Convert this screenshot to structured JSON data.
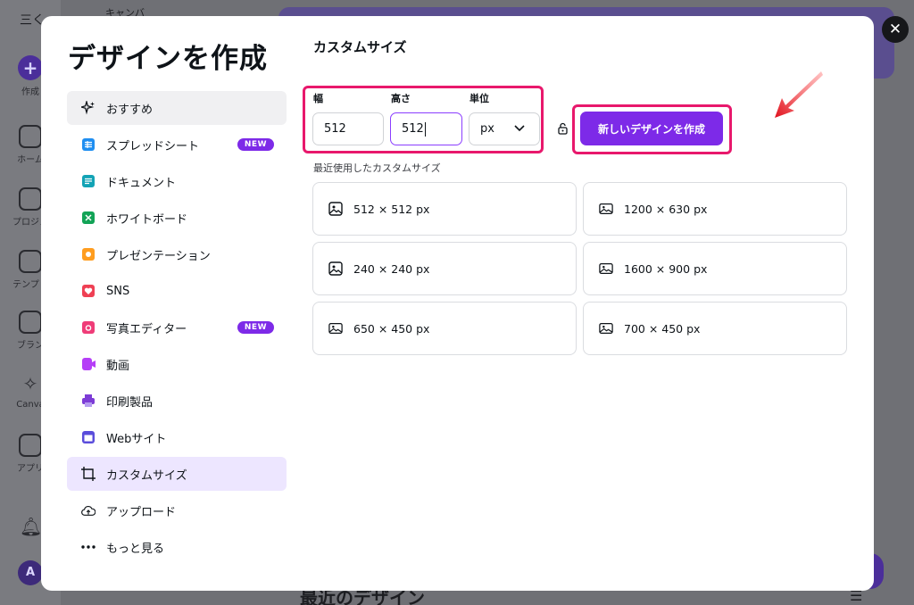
{
  "background": {
    "top_left_text": "三く",
    "top_text": "キャンバ",
    "sidebar_items": [
      "作成",
      "ホーム",
      "プロジェ",
      "テンプレ",
      "ブラン",
      "Canva",
      "アプリ"
    ],
    "avatar_letter": "A",
    "recent_heading": "最近のデザイン"
  },
  "modal": {
    "title": "デザインを作成",
    "close_icon": "close-icon",
    "menu": [
      {
        "label": "おすすめ",
        "icon": "sparkle-icon",
        "badge": ""
      },
      {
        "label": "スプレッドシート",
        "icon": "spreadsheet-icon",
        "badge": "NEW"
      },
      {
        "label": "ドキュメント",
        "icon": "document-icon",
        "badge": ""
      },
      {
        "label": "ホワイトボード",
        "icon": "whiteboard-icon",
        "badge": ""
      },
      {
        "label": "プレゼンテーション",
        "icon": "presentation-icon",
        "badge": ""
      },
      {
        "label": "SNS",
        "icon": "heart-icon",
        "badge": ""
      },
      {
        "label": "写真エディター",
        "icon": "camera-icon",
        "badge": "NEW"
      },
      {
        "label": "動画",
        "icon": "video-icon",
        "badge": ""
      },
      {
        "label": "印刷製品",
        "icon": "printer-icon",
        "badge": ""
      },
      {
        "label": "Webサイト",
        "icon": "website-icon",
        "badge": ""
      },
      {
        "label": "カスタムサイズ",
        "icon": "custom-size-icon",
        "badge": ""
      },
      {
        "label": "アップロード",
        "icon": "cloud-upload-icon",
        "badge": ""
      },
      {
        "label": "もっと見る",
        "icon": "more-dots-icon",
        "badge": ""
      }
    ],
    "custom": {
      "title": "カスタムサイズ",
      "width_label": "幅",
      "width_value": "512",
      "height_label": "高さ",
      "height_value": "512",
      "unit_label": "単位",
      "unit_value": "px",
      "create_button": "新しいデザインを作成",
      "recent_label": "最近使用したカスタムサイズ",
      "recent_sizes": [
        "512 × 512 px",
        "1200 × 630 px",
        "240 × 240 px",
        "1600 × 900 px",
        "650 × 450 px",
        "700 × 450 px"
      ]
    }
  },
  "colors": {
    "accent": "#7d2ae8",
    "highlight": "#e8186c",
    "active_bg": "#ede6ff"
  }
}
